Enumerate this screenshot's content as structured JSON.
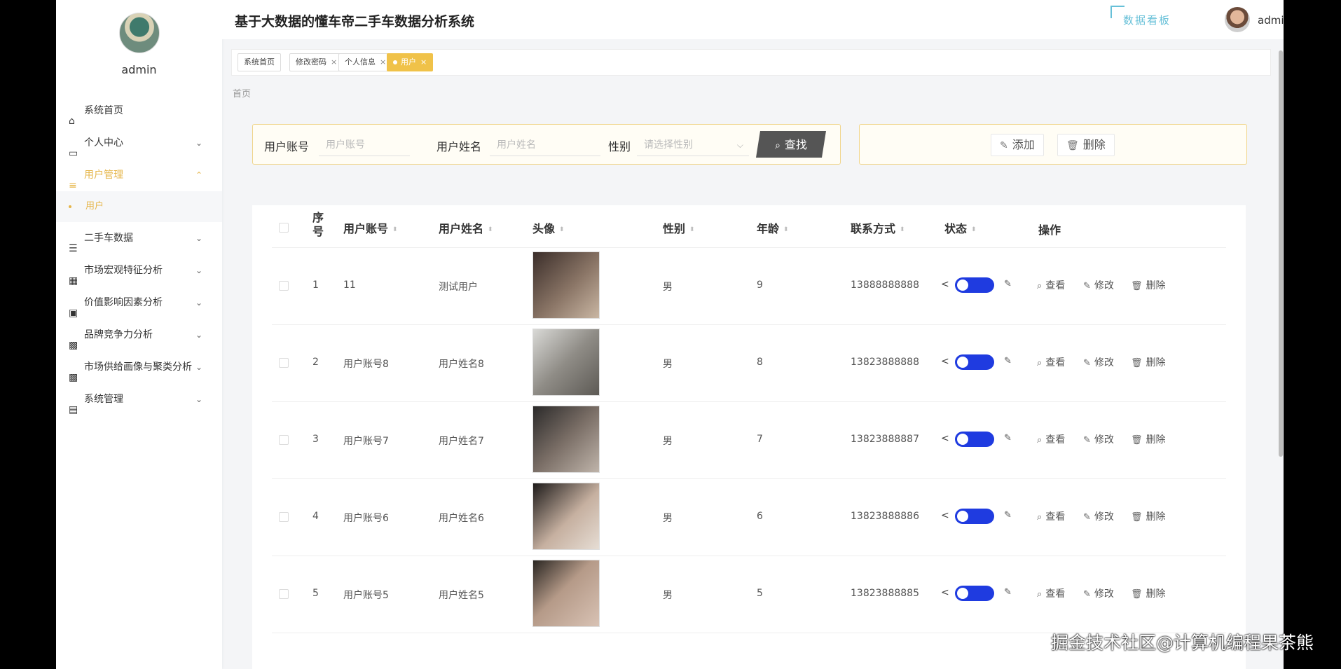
{
  "app": {
    "title": "基于大数据的懂车帝二手车数据分析系统",
    "dashboard_link": "数据看板",
    "user": "admin",
    "caret": "▾"
  },
  "sidebar": {
    "username": "admin",
    "items": [
      {
        "label": "系统首页",
        "icon": "home-icon",
        "has_chevron": false,
        "chev": ""
      },
      {
        "label": "个人中心",
        "icon": "user-card-icon",
        "has_chevron": true,
        "chev": "⌄"
      },
      {
        "label": "用户管理",
        "icon": "list-icon",
        "has_chevron": true,
        "chev": "⌃",
        "active": true
      },
      {
        "label": "二手车数据",
        "icon": "sliders-icon",
        "has_chevron": true,
        "chev": "⌄"
      },
      {
        "label": "市场宏观特征分析",
        "icon": "grid-icon",
        "has_chevron": true,
        "chev": "⌄"
      },
      {
        "label": "价值影响因素分析",
        "icon": "wallet-icon",
        "has_chevron": true,
        "chev": "⌄"
      },
      {
        "label": "品牌竞争力分析",
        "icon": "apps-icon",
        "has_chevron": true,
        "chev": "⌄"
      },
      {
        "label": "市场供给画像与聚类分析",
        "icon": "apps-icon",
        "has_chevron": true,
        "chev": "⌄"
      },
      {
        "label": "系统管理",
        "icon": "clipboard-icon",
        "has_chevron": true,
        "chev": "⌄"
      }
    ],
    "submenu": {
      "label": "用户"
    }
  },
  "tabs": [
    {
      "label": "系统首页",
      "closable": false
    },
    {
      "label": "修改密码",
      "closable": true
    },
    {
      "label": "个人信息",
      "closable": true
    },
    {
      "label": "用户",
      "closable": true,
      "active": true
    }
  ],
  "tab_close": "×",
  "breadcrumb": "首页",
  "search": {
    "account_label": "用户账号",
    "account_placeholder": "用户账号",
    "name_label": "用户姓名",
    "name_placeholder": "用户姓名",
    "gender_label": "性别",
    "gender_placeholder": "请选择性别",
    "button": "查找"
  },
  "actions": {
    "add": "添加",
    "delete": "删除"
  },
  "table": {
    "columns": {
      "index_line1": "序",
      "index_line2": "号",
      "account": "用户账号",
      "name": "用户姓名",
      "avatar": "头像",
      "gender": "性别",
      "age": "年龄",
      "phone": "联系方式",
      "status": "状态",
      "ops": "操作"
    },
    "ops": {
      "view": "查看",
      "edit": "修改",
      "delete": "删除"
    },
    "rows": [
      {
        "index": "1",
        "account": "11",
        "name": "测试用户",
        "gender": "男",
        "age": "9",
        "phone": "13888888888",
        "status_on": true
      },
      {
        "index": "2",
        "account": "用户账号8",
        "name": "用户姓名8",
        "gender": "男",
        "age": "8",
        "phone": "13823888888",
        "status_on": true
      },
      {
        "index": "3",
        "account": "用户账号7",
        "name": "用户姓名7",
        "gender": "男",
        "age": "7",
        "phone": "13823888887",
        "status_on": true
      },
      {
        "index": "4",
        "account": "用户账号6",
        "name": "用户姓名6",
        "gender": "男",
        "age": "6",
        "phone": "13823888886",
        "status_on": true
      },
      {
        "index": "5",
        "account": "用户账号5",
        "name": "用户姓名5",
        "gender": "男",
        "age": "5",
        "phone": "13823888885",
        "status_on": true
      }
    ]
  },
  "watermark": "掘金技术社区@计算机编程果茶熊",
  "colors": {
    "accent": "#e6b64a",
    "toggle": "#1f3be0",
    "dashboard": "#67c0d8"
  }
}
